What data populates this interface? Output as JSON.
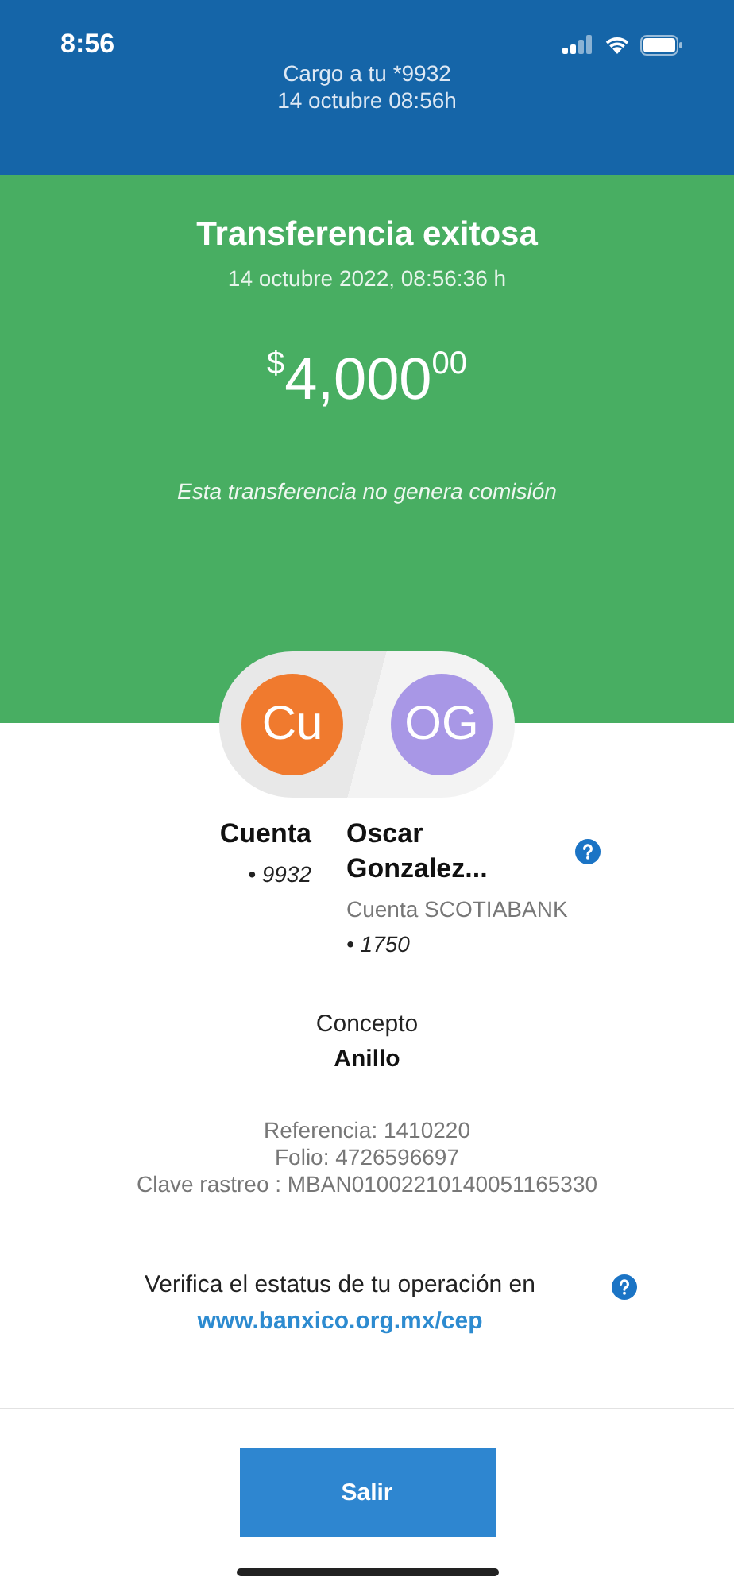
{
  "status_bar": {
    "time": "8:56"
  },
  "header": {
    "charge": "Cargo a tu *9932",
    "date": "14 octubre 08:56h"
  },
  "summary": {
    "title": "Transferencia exitosa",
    "date": "14 octubre 2022, 08:56:36 h",
    "amount": {
      "currency": "$",
      "whole": "4,000",
      "cents": "00"
    },
    "note": "Esta transferencia no genera comisión"
  },
  "parties": [
    {
      "kind": "origin",
      "initials": "Cu",
      "color": "#f07a2e",
      "name": "Cuenta",
      "account": "• 9932"
    },
    {
      "kind": "destination",
      "initials": "OG",
      "color": "#a897e6",
      "name": "Oscar Gonzalez...",
      "bank": "Cuenta SCOTIABANK",
      "account": "• 1750"
    }
  ],
  "concept": {
    "label": "Concepto",
    "value": "Anillo"
  },
  "references": [
    "Referencia: 1410220",
    "Folio: 4726596697",
    "Clave rastreo : MBAN01002210140051165330"
  ],
  "verify": {
    "text": "Verifica el estatus de tu operación en",
    "link": "www.banxico.org.mx/cep"
  },
  "button": "Salir"
}
